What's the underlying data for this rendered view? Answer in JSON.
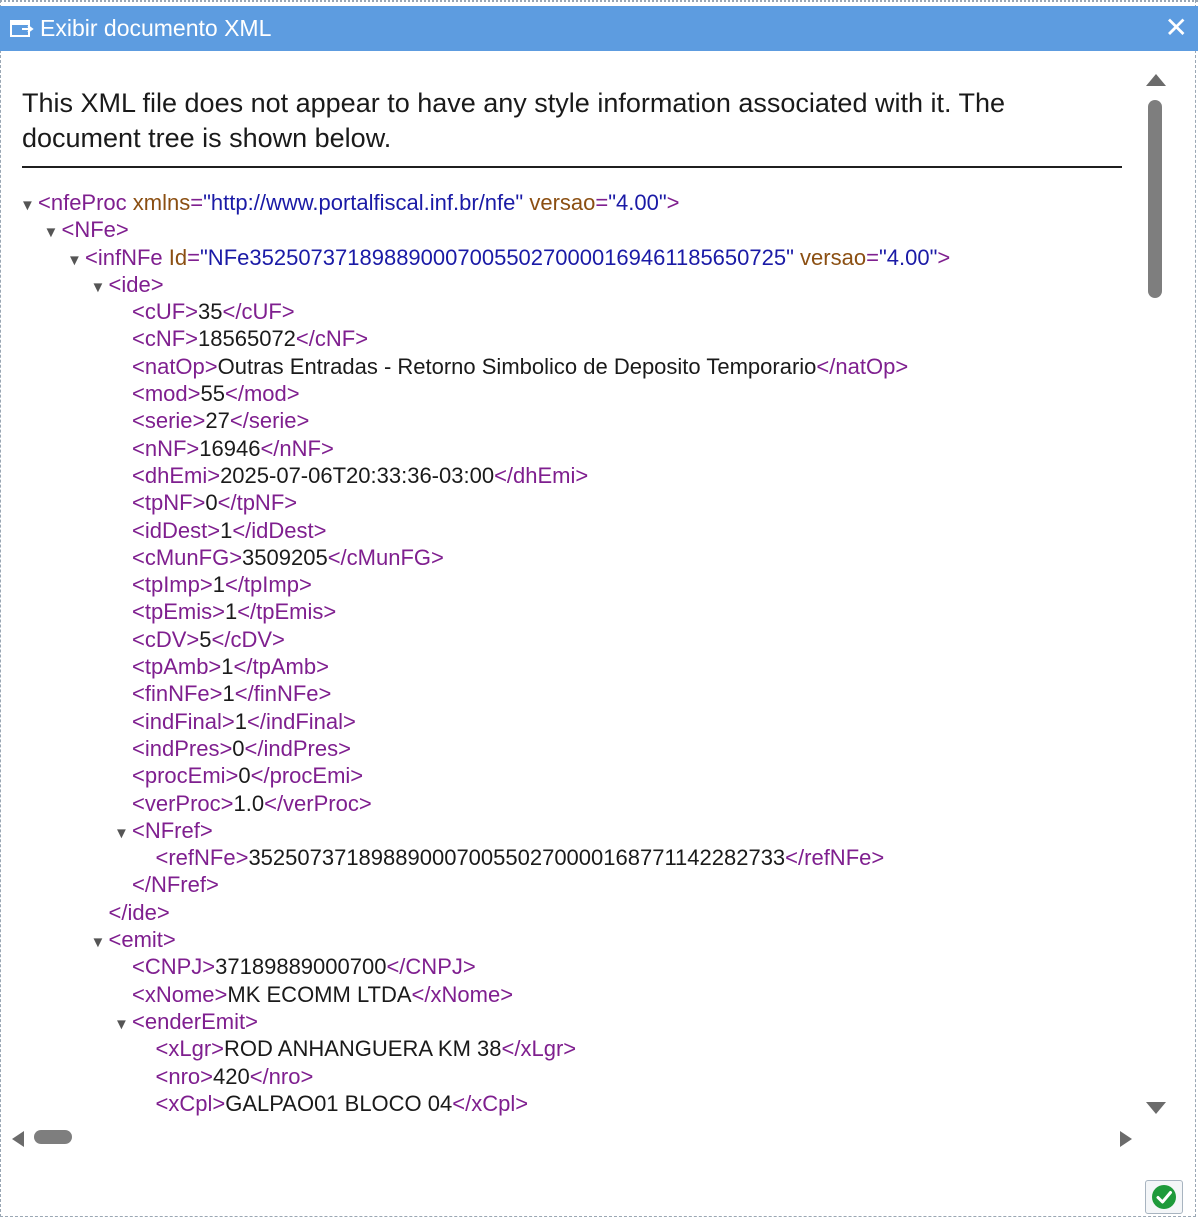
{
  "window": {
    "title": "Exibir documento XML",
    "close_glyph": "✕",
    "title_icon": "window-icon",
    "title_bar_color": "#5d9ce0"
  },
  "notice": "This XML file does not appear to have any style information associated with it. The document tree is shown below.",
  "colors": {
    "tag": "#7f1f8f",
    "attr_name": "#8b4f12",
    "attr_value": "#1a1aa6",
    "text": "#1a1a1a"
  },
  "xml_lines": [
    {
      "depth": 0,
      "toggle": "▼",
      "parts": [
        [
          "t",
          "<nfeProc"
        ],
        [
          "x",
          " "
        ],
        [
          "n",
          "xmlns"
        ],
        [
          "t",
          "="
        ],
        [
          "v",
          "\"http://www.portalfiscal.inf.br/nfe\""
        ],
        [
          "x",
          " "
        ],
        [
          "n",
          "versao"
        ],
        [
          "t",
          "="
        ],
        [
          "v",
          "\"4.00\""
        ],
        [
          "t",
          ">"
        ]
      ]
    },
    {
      "depth": 1,
      "toggle": "▼",
      "parts": [
        [
          "t",
          "<NFe>"
        ]
      ]
    },
    {
      "depth": 2,
      "toggle": "▼",
      "parts": [
        [
          "t",
          "<infNFe"
        ],
        [
          "x",
          " "
        ],
        [
          "n",
          "Id"
        ],
        [
          "t",
          "="
        ],
        [
          "v",
          "\"NFe35250737189889000700550270000169461185650725\""
        ],
        [
          "x",
          " "
        ],
        [
          "n",
          "versao"
        ],
        [
          "t",
          "="
        ],
        [
          "v",
          "\"4.00\""
        ],
        [
          "t",
          ">"
        ]
      ]
    },
    {
      "depth": 3,
      "toggle": "▼",
      "parts": [
        [
          "t",
          "<ide>"
        ]
      ]
    },
    {
      "depth": 4,
      "toggle": "",
      "parts": [
        [
          "t",
          "<cUF>"
        ],
        [
          "x",
          "35"
        ],
        [
          "t",
          "</cUF>"
        ]
      ]
    },
    {
      "depth": 4,
      "toggle": "",
      "parts": [
        [
          "t",
          "<cNF>"
        ],
        [
          "x",
          "18565072"
        ],
        [
          "t",
          "</cNF>"
        ]
      ]
    },
    {
      "depth": 4,
      "toggle": "",
      "parts": [
        [
          "t",
          "<natOp>"
        ],
        [
          "x",
          "Outras Entradas - Retorno Simbolico de Deposito Temporario"
        ],
        [
          "t",
          "</natOp>"
        ]
      ]
    },
    {
      "depth": 4,
      "toggle": "",
      "parts": [
        [
          "t",
          "<mod>"
        ],
        [
          "x",
          "55"
        ],
        [
          "t",
          "</mod>"
        ]
      ]
    },
    {
      "depth": 4,
      "toggle": "",
      "parts": [
        [
          "t",
          "<serie>"
        ],
        [
          "x",
          "27"
        ],
        [
          "t",
          "</serie>"
        ]
      ]
    },
    {
      "depth": 4,
      "toggle": "",
      "parts": [
        [
          "t",
          "<nNF>"
        ],
        [
          "x",
          "16946"
        ],
        [
          "t",
          "</nNF>"
        ]
      ]
    },
    {
      "depth": 4,
      "toggle": "",
      "parts": [
        [
          "t",
          "<dhEmi>"
        ],
        [
          "x",
          "2025-07-06T20:33:36-03:00"
        ],
        [
          "t",
          "</dhEmi>"
        ]
      ]
    },
    {
      "depth": 4,
      "toggle": "",
      "parts": [
        [
          "t",
          "<tpNF>"
        ],
        [
          "x",
          "0"
        ],
        [
          "t",
          "</tpNF>"
        ]
      ]
    },
    {
      "depth": 4,
      "toggle": "",
      "parts": [
        [
          "t",
          "<idDest>"
        ],
        [
          "x",
          "1"
        ],
        [
          "t",
          "</idDest>"
        ]
      ]
    },
    {
      "depth": 4,
      "toggle": "",
      "parts": [
        [
          "t",
          "<cMunFG>"
        ],
        [
          "x",
          "3509205"
        ],
        [
          "t",
          "</cMunFG>"
        ]
      ]
    },
    {
      "depth": 4,
      "toggle": "",
      "parts": [
        [
          "t",
          "<tpImp>"
        ],
        [
          "x",
          "1"
        ],
        [
          "t",
          "</tpImp>"
        ]
      ]
    },
    {
      "depth": 4,
      "toggle": "",
      "parts": [
        [
          "t",
          "<tpEmis>"
        ],
        [
          "x",
          "1"
        ],
        [
          "t",
          "</tpEmis>"
        ]
      ]
    },
    {
      "depth": 4,
      "toggle": "",
      "parts": [
        [
          "t",
          "<cDV>"
        ],
        [
          "x",
          "5"
        ],
        [
          "t",
          "</cDV>"
        ]
      ]
    },
    {
      "depth": 4,
      "toggle": "",
      "parts": [
        [
          "t",
          "<tpAmb>"
        ],
        [
          "x",
          "1"
        ],
        [
          "t",
          "</tpAmb>"
        ]
      ]
    },
    {
      "depth": 4,
      "toggle": "",
      "parts": [
        [
          "t",
          "<finNFe>"
        ],
        [
          "x",
          "1"
        ],
        [
          "t",
          "</finNFe>"
        ]
      ]
    },
    {
      "depth": 4,
      "toggle": "",
      "parts": [
        [
          "t",
          "<indFinal>"
        ],
        [
          "x",
          "1"
        ],
        [
          "t",
          "</indFinal>"
        ]
      ]
    },
    {
      "depth": 4,
      "toggle": "",
      "parts": [
        [
          "t",
          "<indPres>"
        ],
        [
          "x",
          "0"
        ],
        [
          "t",
          "</indPres>"
        ]
      ]
    },
    {
      "depth": 4,
      "toggle": "",
      "parts": [
        [
          "t",
          "<procEmi>"
        ],
        [
          "x",
          "0"
        ],
        [
          "t",
          "</procEmi>"
        ]
      ]
    },
    {
      "depth": 4,
      "toggle": "",
      "parts": [
        [
          "t",
          "<verProc>"
        ],
        [
          "x",
          "1.0"
        ],
        [
          "t",
          "</verProc>"
        ]
      ]
    },
    {
      "depth": 4,
      "toggle": "▼",
      "parts": [
        [
          "t",
          "<NFref>"
        ]
      ]
    },
    {
      "depth": 5,
      "toggle": "",
      "parts": [
        [
          "t",
          "<refNFe>"
        ],
        [
          "x",
          "35250737189889000700550270000168771142282733"
        ],
        [
          "t",
          "</refNFe>"
        ]
      ]
    },
    {
      "depth": 4,
      "toggle": "",
      "parts": [
        [
          "t",
          "</NFref>"
        ]
      ]
    },
    {
      "depth": 3,
      "toggle": "",
      "parts": [
        [
          "t",
          "</ide>"
        ]
      ]
    },
    {
      "depth": 3,
      "toggle": "▼",
      "parts": [
        [
          "t",
          "<emit>"
        ]
      ]
    },
    {
      "depth": 4,
      "toggle": "",
      "parts": [
        [
          "t",
          "<CNPJ>"
        ],
        [
          "x",
          "37189889000700"
        ],
        [
          "t",
          "</CNPJ>"
        ]
      ]
    },
    {
      "depth": 4,
      "toggle": "",
      "parts": [
        [
          "t",
          "<xNome>"
        ],
        [
          "x",
          "MK ECOMM LTDA"
        ],
        [
          "t",
          "</xNome>"
        ]
      ]
    },
    {
      "depth": 4,
      "toggle": "▼",
      "parts": [
        [
          "t",
          "<enderEmit>"
        ]
      ]
    },
    {
      "depth": 5,
      "toggle": "",
      "parts": [
        [
          "t",
          "<xLgr>"
        ],
        [
          "x",
          "ROD ANHANGUERA KM 38"
        ],
        [
          "t",
          "</xLgr>"
        ]
      ]
    },
    {
      "depth": 5,
      "toggle": "",
      "parts": [
        [
          "t",
          "<nro>"
        ],
        [
          "x",
          "420"
        ],
        [
          "t",
          "</nro>"
        ]
      ]
    },
    {
      "depth": 5,
      "toggle": "",
      "parts": [
        [
          "t",
          "<xCpl>"
        ],
        [
          "x",
          "GALPAO01 BLOCO 04"
        ],
        [
          "t",
          "</xCpl>"
        ]
      ]
    }
  ],
  "scrollbars": {
    "up_icon": "arrow-up-icon",
    "down_icon": "arrow-down-icon",
    "left_icon": "arrow-left-icon",
    "right_icon": "arrow-right-icon"
  },
  "footer": {
    "ok_icon": "checkmark-icon",
    "ok_color": "#1e9a3a"
  }
}
